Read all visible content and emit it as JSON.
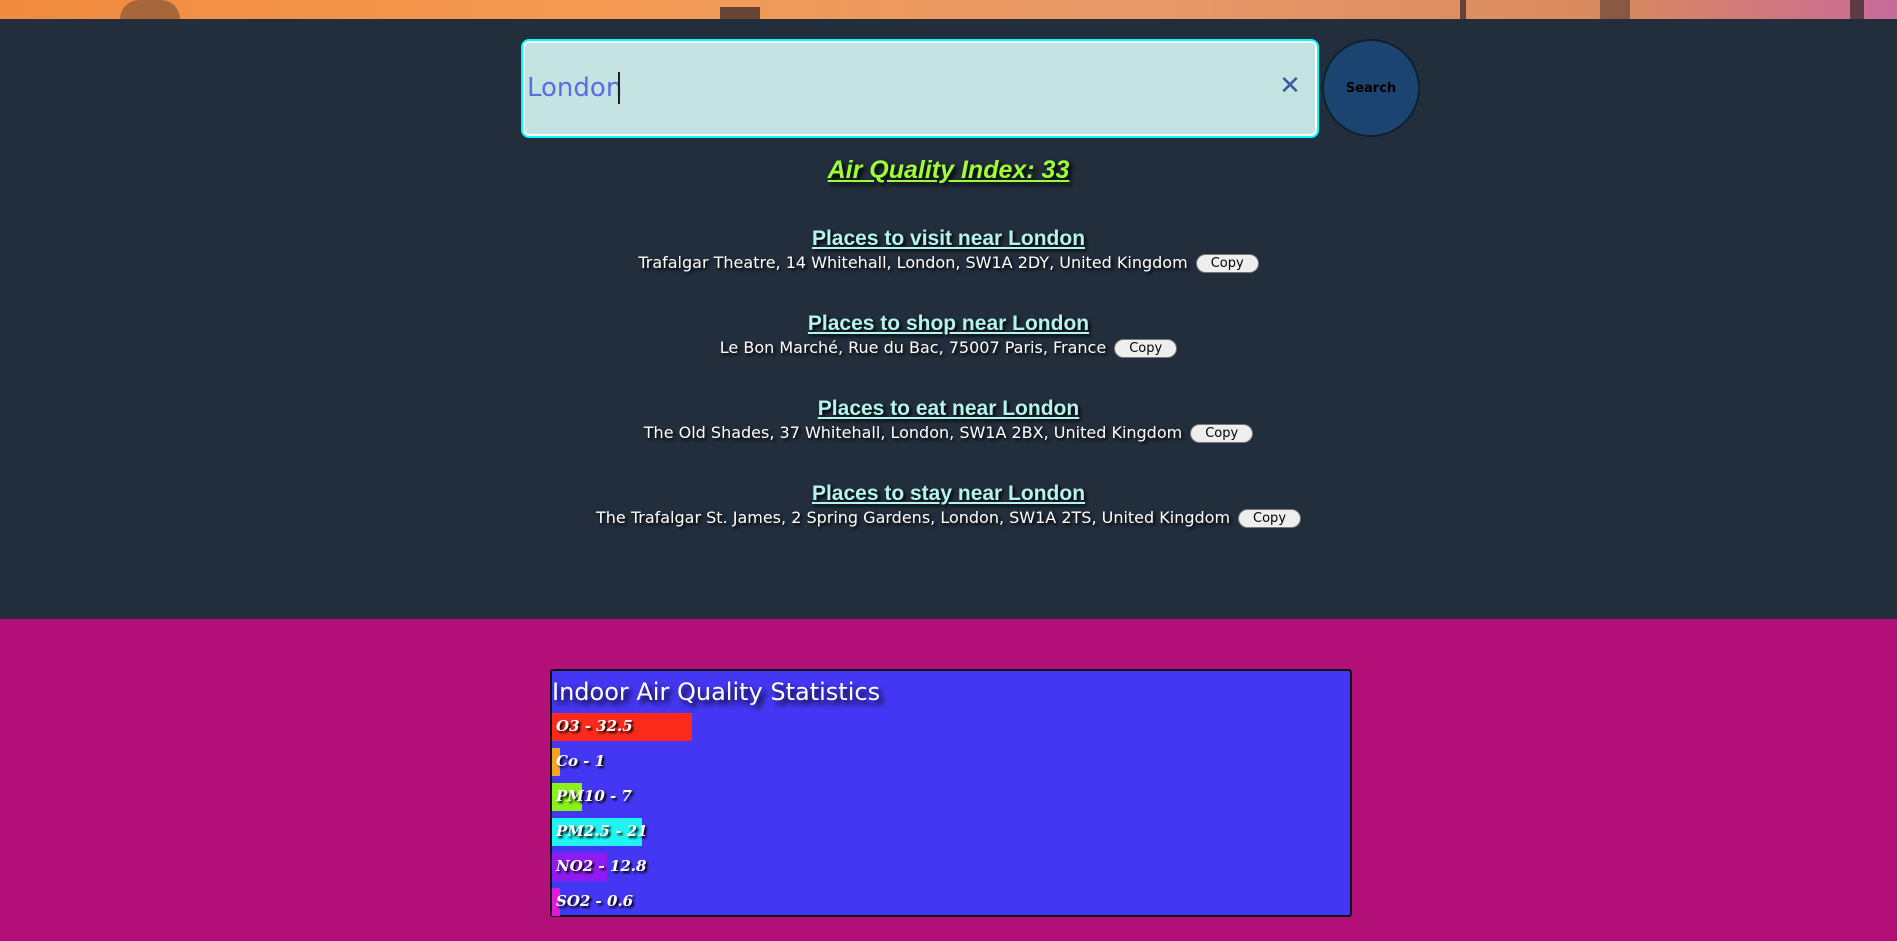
{
  "search": {
    "value": "London",
    "clear_icon": "close-icon",
    "button_label": "Search"
  },
  "aqi": {
    "text": "Air Quality Index: 33"
  },
  "places": [
    {
      "title": "Places to visit near London",
      "address": "Trafalgar Theatre, 14 Whitehall, London, SW1A 2DY, United Kingdom",
      "copy_label": "Copy"
    },
    {
      "title": "Places to shop near London",
      "address": "Le Bon Marché, Rue du Bac, 75007 Paris, France",
      "copy_label": "Copy"
    },
    {
      "title": "Places to eat near London",
      "address": "The Old Shades, 37 Whitehall, London, SW1A 2BX, United Kingdom",
      "copy_label": "Copy"
    },
    {
      "title": "Places to stay near London",
      "address": "The Trafalgar St. James, 2 Spring Gardens, London, SW1A 2TS, United Kingdom",
      "copy_label": "Copy"
    }
  ],
  "stats": {
    "title": "Indoor Air Quality Statistics"
  },
  "chart_data": {
    "type": "bar",
    "title": "Indoor Air Quality Statistics",
    "categories": [
      "O3",
      "Co",
      "PM10",
      "PM2.5",
      "NO2",
      "SO2"
    ],
    "values": [
      32.5,
      1,
      7,
      21,
      12.8,
      0.6
    ],
    "labels": [
      "O3 - 32.5",
      "Co - 1",
      "PM10 - 7",
      "PM2.5 - 21",
      "NO2 - 12.8",
      "SO2 - 0.6"
    ],
    "colors": [
      "#fb2a1a",
      "#f5a320",
      "#8af11c",
      "#1ff4f2",
      "#8f1bf2",
      "#e11ad8"
    ]
  }
}
